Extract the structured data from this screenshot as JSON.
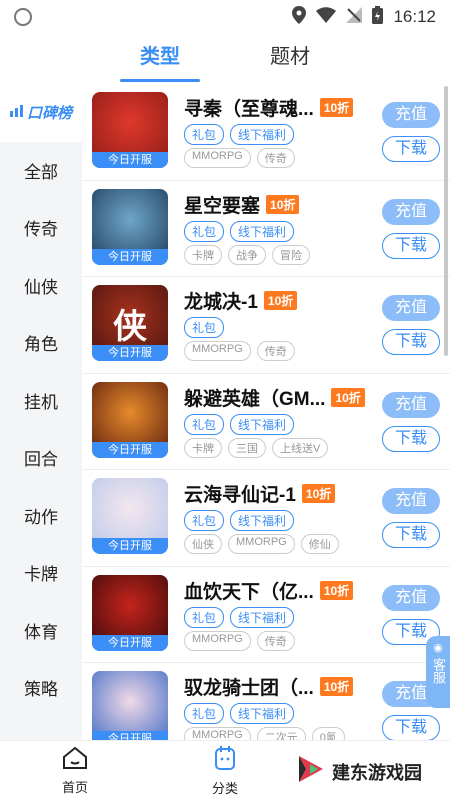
{
  "status": {
    "time": "16:12"
  },
  "tabs": [
    {
      "label": "类型",
      "active": true
    },
    {
      "label": "题材",
      "active": false
    }
  ],
  "sidebar": {
    "items": [
      {
        "label": "口碑榜"
      },
      {
        "label": "全部"
      },
      {
        "label": "传奇"
      },
      {
        "label": "仙侠"
      },
      {
        "label": "角色"
      },
      {
        "label": "挂机"
      },
      {
        "label": "回合"
      },
      {
        "label": "动作"
      },
      {
        "label": "卡牌"
      },
      {
        "label": "体育"
      },
      {
        "label": "策略"
      }
    ]
  },
  "games": [
    {
      "name": "寻秦（至尊魂...",
      "discount": "10折",
      "badge": "今日开服",
      "tags": [
        "礼包",
        "线下福利"
      ],
      "genres": [
        "MMORPG",
        "传奇"
      ],
      "recharge": "充值",
      "download": "下载",
      "colors": [
        "#8a1c16",
        "#e0382c"
      ],
      "glyph": ""
    },
    {
      "name": "星空要塞",
      "discount": "10折",
      "badge": "今日开服",
      "tags": [
        "礼包",
        "线下福利"
      ],
      "genres": [
        "卡牌",
        "战争",
        "冒险"
      ],
      "recharge": "充值",
      "download": "下载",
      "colors": [
        "#1c3b5a",
        "#6ea6c9"
      ],
      "glyph": ""
    },
    {
      "name": "龙城决-1",
      "discount": "10折",
      "badge": "今日开服",
      "tags": [
        "礼包"
      ],
      "genres": [
        "MMORPG",
        "传奇"
      ],
      "recharge": "充值",
      "download": "下载",
      "colors": [
        "#4a1410",
        "#a8321c"
      ],
      "glyph": "侠"
    },
    {
      "name": "躲避英雄（GM...",
      "discount": "10折",
      "badge": "今日开服",
      "tags": [
        "礼包",
        "线下福利"
      ],
      "genres": [
        "卡牌",
        "三国",
        "上线送V"
      ],
      "recharge": "充值",
      "download": "下载",
      "colors": [
        "#5a1c0c",
        "#e68a2c"
      ],
      "glyph": ""
    },
    {
      "name": "云海寻仙记-1",
      "discount": "10折",
      "badge": "今日开服",
      "tags": [
        "礼包",
        "线下福利"
      ],
      "genres": [
        "仙侠",
        "MMORPG",
        "修仙"
      ],
      "recharge": "充值",
      "download": "下载",
      "colors": [
        "#b9c8ea",
        "#f3e6ee"
      ],
      "glyph": ""
    },
    {
      "name": "血饮天下（亿...",
      "discount": "10折",
      "badge": "今日开服",
      "tags": [
        "礼包",
        "线下福利"
      ],
      "genres": [
        "MMORPG",
        "传奇"
      ],
      "recharge": "充值",
      "download": "下载",
      "colors": [
        "#3a0a0a",
        "#c4241c"
      ],
      "glyph": ""
    },
    {
      "name": "驭龙骑士团（...",
      "discount": "10折",
      "badge": "今日开服",
      "tags": [
        "礼包",
        "线下福利"
      ],
      "genres": [
        "MMORPG",
        "二次元",
        "0氪"
      ],
      "recharge": "充值",
      "download": "下载",
      "colors": [
        "#3a6ac4",
        "#f2d9e8"
      ],
      "glyph": ""
    }
  ],
  "service": "客服",
  "bottom_nav": [
    {
      "label": "首页",
      "icon": "home-icon"
    },
    {
      "label": "分类",
      "icon": "category-icon"
    }
  ],
  "watermark": "建东游戏园"
}
